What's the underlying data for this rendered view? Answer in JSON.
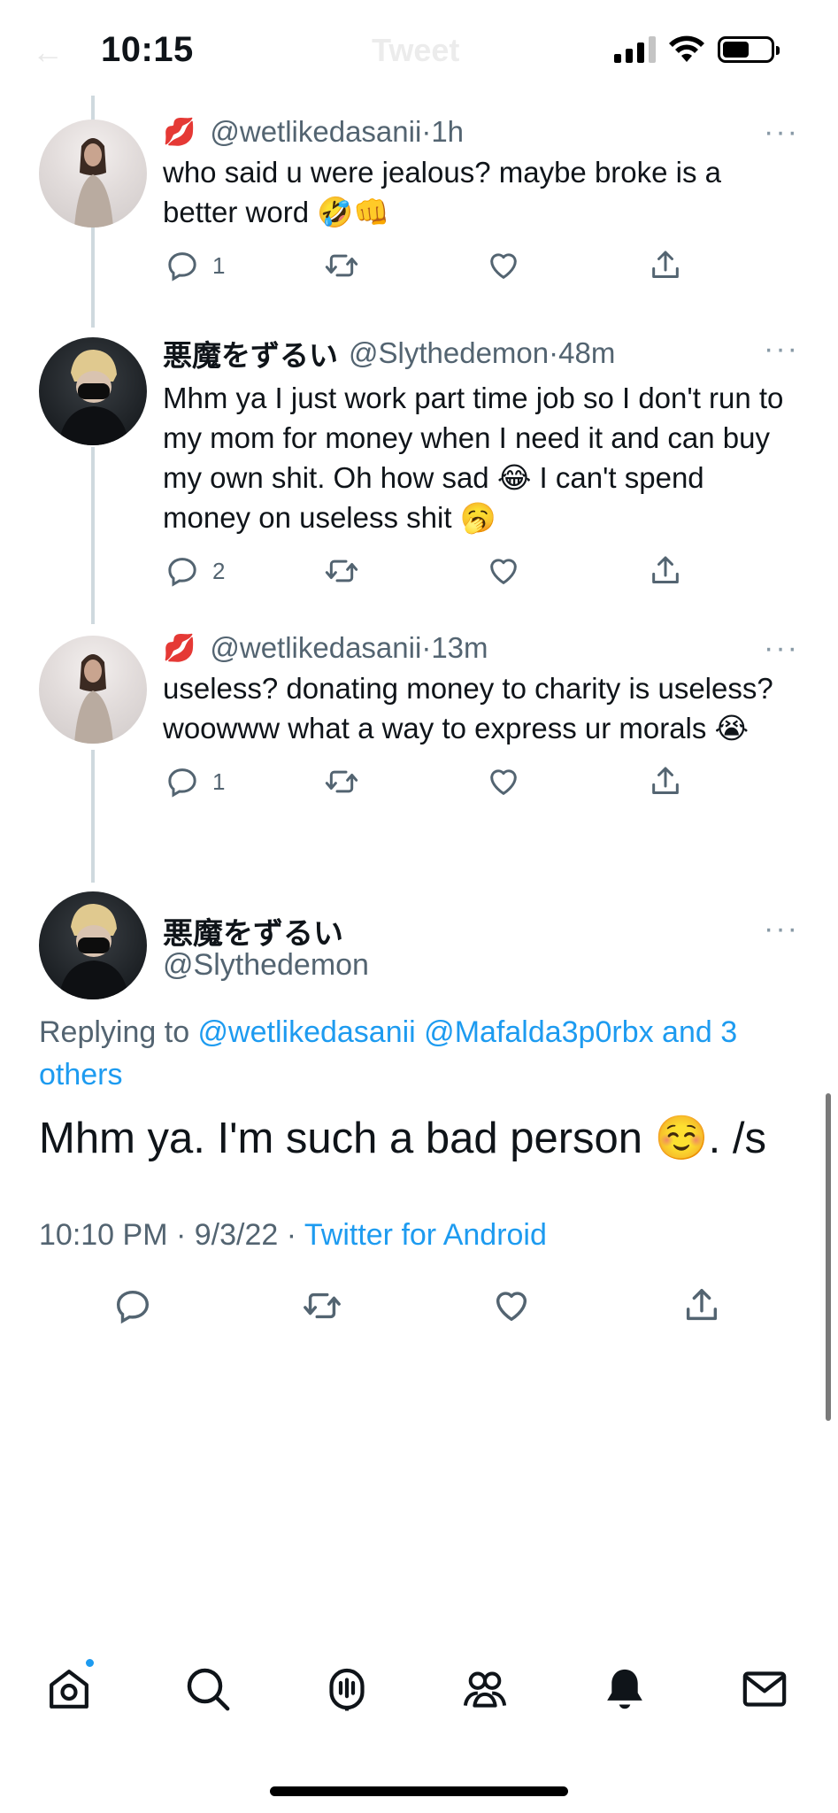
{
  "status_bar": {
    "time": "10:15",
    "back_glyph": "←",
    "faded_title": "Tweet"
  },
  "tweets": [
    {
      "emoji_name": "💋",
      "name": "",
      "handle": "@wetlikedasanii",
      "time": "1h",
      "text": "who said u were jealous? maybe broke is a better word 🤣👊",
      "reply_count": "1"
    },
    {
      "emoji_name": "",
      "name": "悪魔をずるい",
      "handle": "@Slythedemon",
      "time": "48m",
      "text": "Mhm ya I just work part time job so I don't run to my mom for money when I need it and can buy my own shit. Oh how sad 😂 I can't spend money on useless shit 🥱",
      "reply_count": "2"
    },
    {
      "emoji_name": "💋",
      "name": "",
      "handle": "@wetlikedasanii",
      "time": "13m",
      "text": "useless? donating money to charity is useless? woowww what a way to express ur morals 😭",
      "reply_count": "1"
    }
  ],
  "main_tweet": {
    "name": "悪魔をずるい",
    "handle": "@Slythedemon",
    "replying_prefix": "Replying to ",
    "replying_users": "@wetlikedasanii @Mafalda3p0rbx and 3 others",
    "text": "Mhm ya. I'm such a bad person ☺️. /s",
    "datetime": "10:10 PM · 9/3/22 · ",
    "source": "Twitter for Android"
  },
  "separator": " · ",
  "more_glyph": "···",
  "icons": {
    "reply": "reply-icon",
    "retweet": "retweet-icon",
    "like": "heart-icon",
    "share": "share-icon",
    "home": "home-icon",
    "search": "search-icon",
    "spaces": "spaces-icon",
    "communities": "communities-icon",
    "notifications": "bell-icon",
    "messages": "mail-icon"
  },
  "colors": {
    "accent": "#1d9bf0",
    "secondary_text": "#536471",
    "thread_line": "#cfd9de"
  }
}
